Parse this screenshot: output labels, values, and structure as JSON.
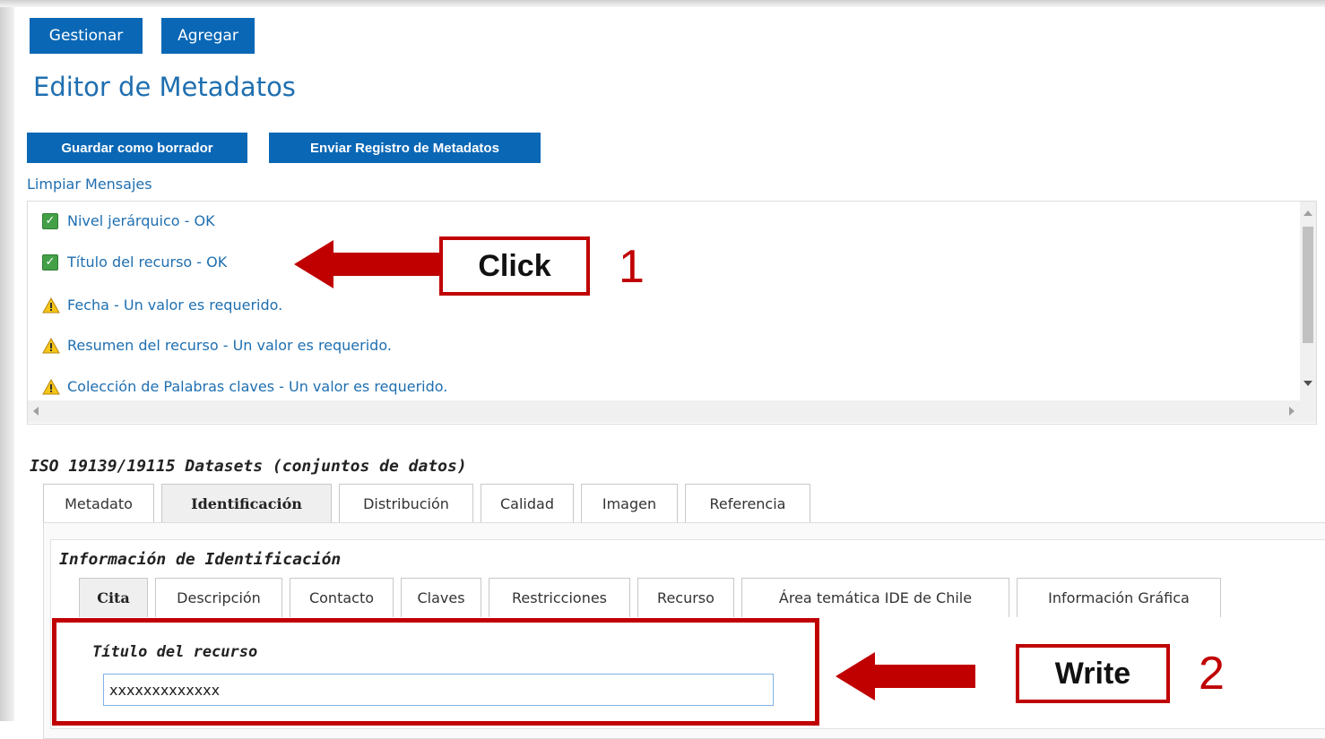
{
  "toolbar": {
    "gestionar": "Gestionar",
    "agregar": "Agregar"
  },
  "page_title": "Editor de Metadatos",
  "actions": {
    "guardar": "Guardar como borrador",
    "enviar": "Enviar Registro de Metadatos"
  },
  "limpiar_link": "Limpiar Mensajes",
  "messages": [
    {
      "text": "Nivel jerárquico - OK",
      "status": "ok"
    },
    {
      "text": "Título del recurso - OK",
      "status": "ok"
    },
    {
      "text": "Fecha - Un valor es requerido.",
      "status": "warning"
    },
    {
      "text": "Resumen del recurso - Un valor es requerido.",
      "status": "warning"
    },
    {
      "text": "Colección de Palabras claves - Un valor es requerido.",
      "status": "warning"
    }
  ],
  "schema_title": "ISO 19139/19115 Datasets (conjuntos de datos)",
  "main_tabs": [
    {
      "label": "Metadato"
    },
    {
      "label": "Identificación",
      "active": true
    },
    {
      "label": "Distribución"
    },
    {
      "label": "Calidad"
    },
    {
      "label": "Imagen"
    },
    {
      "label": "Referencia"
    }
  ],
  "section_title": "Información de Identificación",
  "sub_tabs": [
    {
      "label": "Cita",
      "active": true
    },
    {
      "label": "Descripción"
    },
    {
      "label": "Contacto"
    },
    {
      "label": "Claves"
    },
    {
      "label": "Restricciones"
    },
    {
      "label": "Recurso"
    },
    {
      "label": "Área temática IDE de Chile"
    },
    {
      "label": "Información Gráfica"
    }
  ],
  "field": {
    "label": "Título del recurso",
    "value": "xxxxxxxxxxxxx"
  },
  "annotations": {
    "callout1": "Click",
    "step1": "1",
    "callout2": "Write",
    "step2": "2"
  },
  "colors": {
    "primary": "#0a67b5",
    "link": "#1f6fb0",
    "annotation_red": "#c00000",
    "ok_green": "#43a047",
    "warning_yellow": "#f5c518"
  }
}
